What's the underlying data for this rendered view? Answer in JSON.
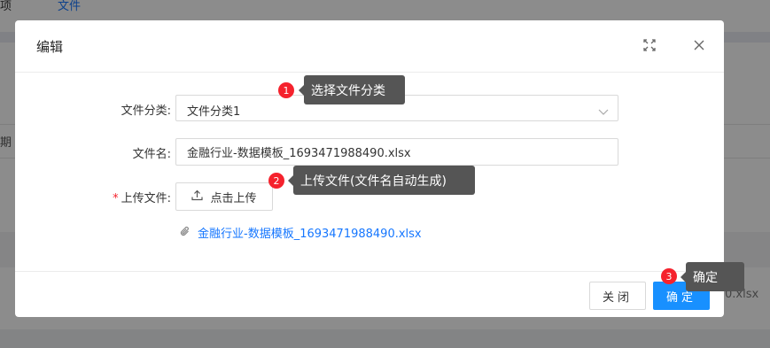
{
  "background": {
    "tabs": [
      "项",
      "文件"
    ],
    "column_fragment": "期",
    "cell_fragment": "0.xlsx"
  },
  "modal": {
    "title": "编辑",
    "fields": {
      "category": {
        "label": "文件分类:",
        "value": "文件分类1"
      },
      "filename": {
        "label": "文件名:",
        "value": "金融行业-数据模板_1693471988490.xlsx"
      },
      "upload": {
        "required_mark": "*",
        "label": "上传文件:",
        "button_label": "点击上传"
      }
    },
    "attachment": {
      "name": "金融行业-数据模板_1693471988490.xlsx"
    },
    "footer": {
      "close_label": "关闭",
      "ok_label": "确定"
    }
  },
  "annotations": [
    {
      "number": "1",
      "text": "选择文件分类"
    },
    {
      "number": "2",
      "text": "上传文件(文件名自动生成)"
    },
    {
      "number": "3",
      "text": "确定"
    }
  ],
  "icons": [
    "maximize-icon",
    "close-icon",
    "chevron-down-icon",
    "upload-icon",
    "paperclip-icon"
  ],
  "colors": {
    "primary": "#1890ff",
    "link": "#1677ff",
    "badge": "#f5222d",
    "callout": "#555555"
  }
}
